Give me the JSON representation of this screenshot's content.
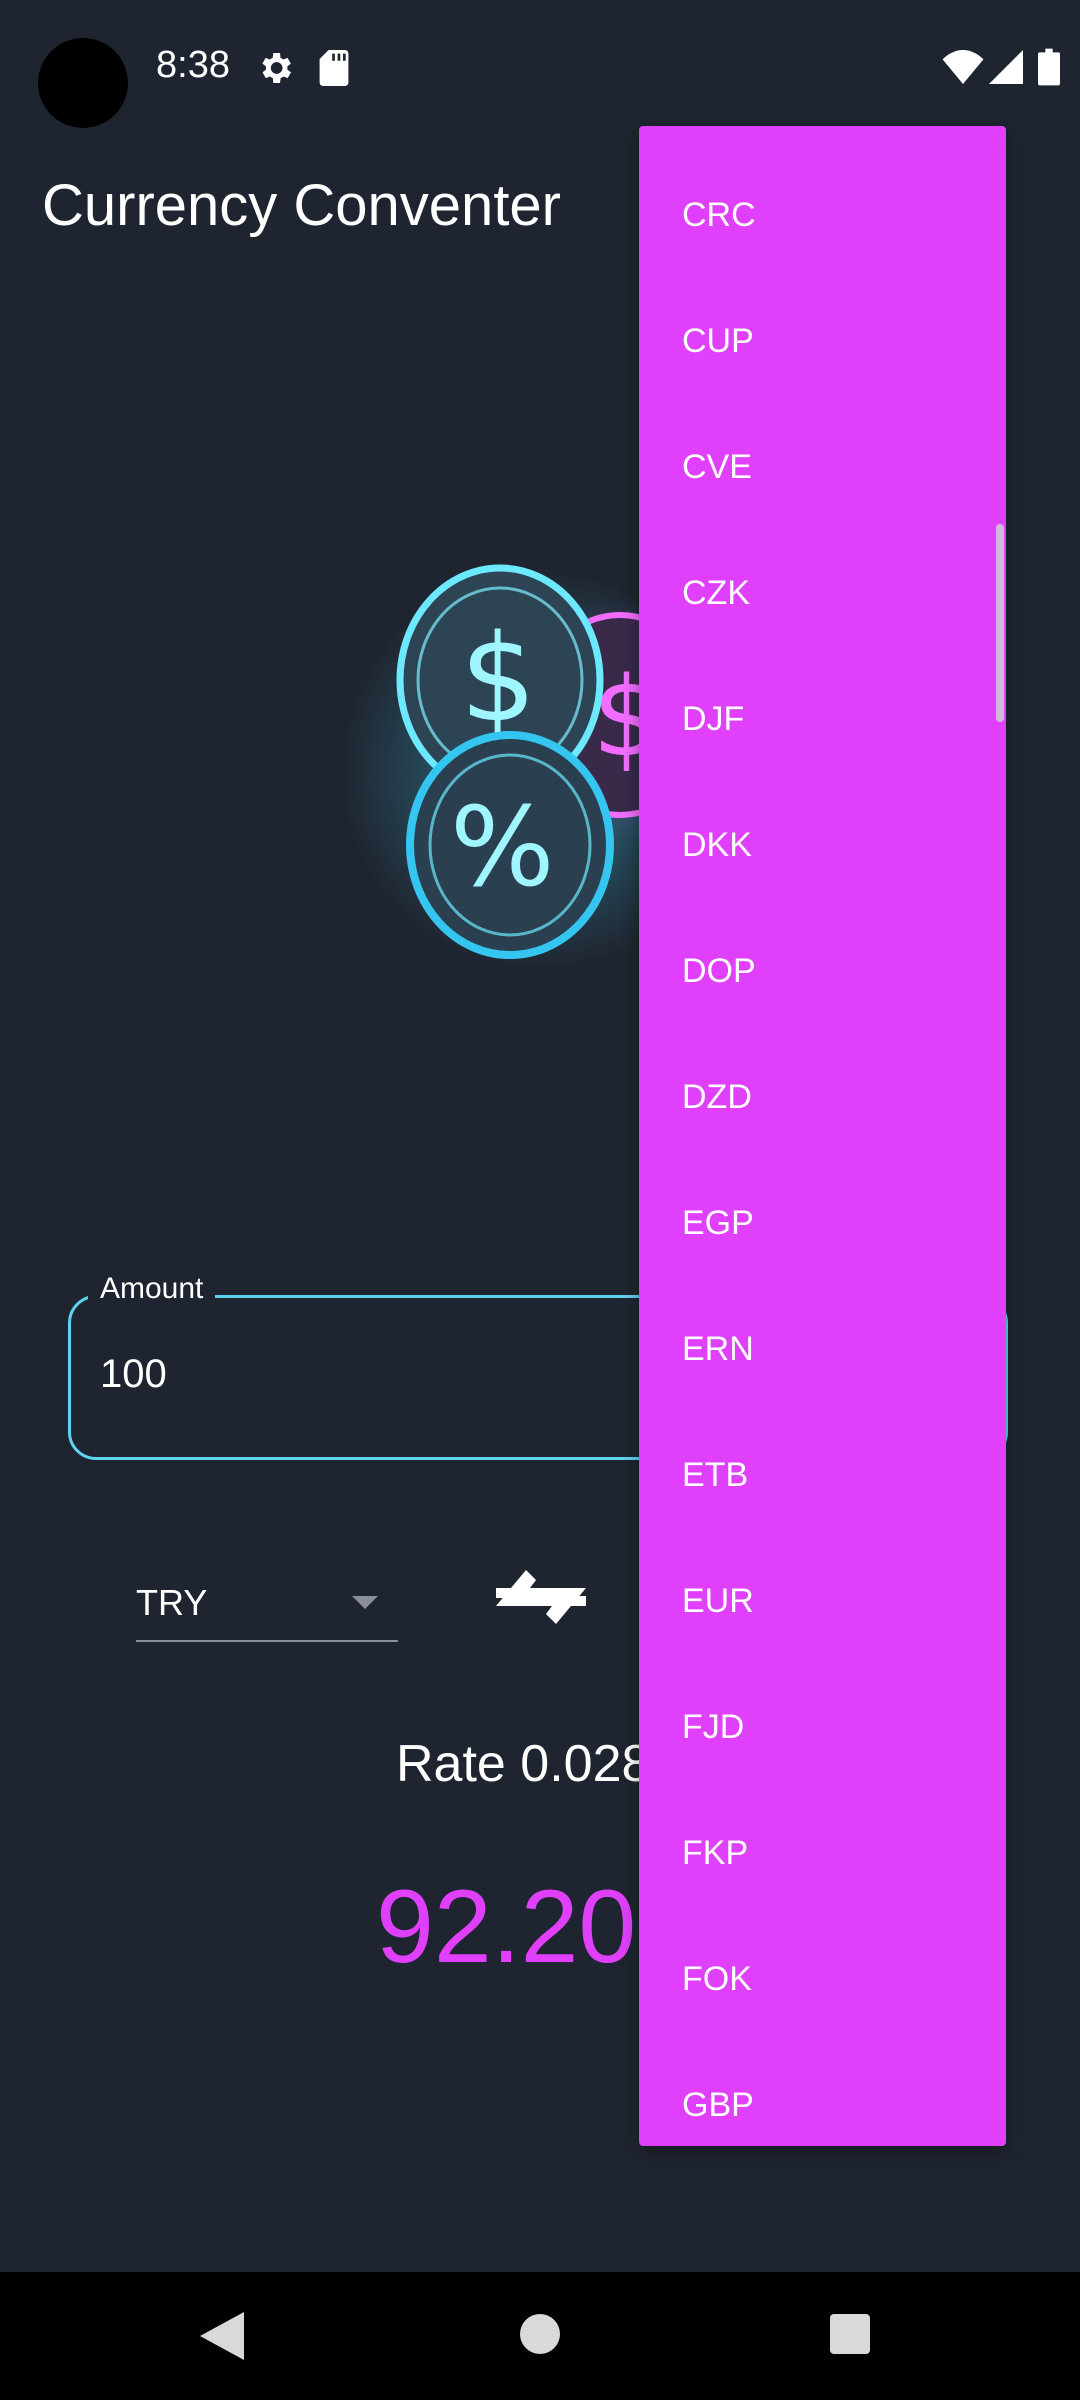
{
  "status_bar": {
    "time": "8:38",
    "icons": [
      "gear-icon",
      "sd-card-icon",
      "wifi-icon",
      "cell-signal-icon",
      "battery-icon"
    ]
  },
  "app": {
    "title": "Currency Conventer"
  },
  "amount": {
    "label": "Amount",
    "value": "100"
  },
  "converter": {
    "from_currency": "TRY",
    "swap_icon": "swap-arrows-icon",
    "rate_text": "Rate 0.028",
    "result_text": "92.20"
  },
  "dropdown": {
    "items": [
      "CRC",
      "CUP",
      "CVE",
      "CZK",
      "DJF",
      "DKK",
      "DOP",
      "DZD",
      "EGP",
      "ERN",
      "ETB",
      "EUR",
      "FJD",
      "FKP",
      "FOK",
      "GBP"
    ]
  },
  "colors": {
    "background": "#1f2530",
    "accent": "#e040fb",
    "field_outline": "#5fd3ee"
  },
  "nav_bar": {
    "icons": [
      "back-icon",
      "home-icon",
      "recents-icon"
    ]
  }
}
